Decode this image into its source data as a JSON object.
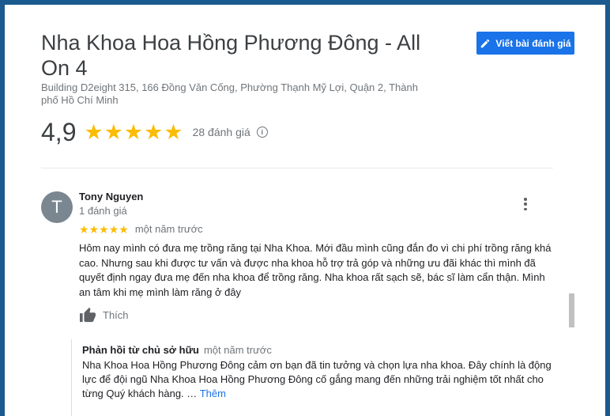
{
  "business": {
    "title": "Nha Khoa Hoa Hồng Phương Đông - All On 4",
    "address": "Building D2eight 315, 166 Đồng Văn Cống, Phường Thạnh Mỹ Lợi, Quận 2, Thành phố Hồ Chí Minh",
    "rating": "4,9",
    "rating_value": 4.9,
    "review_count": "28 đánh giá",
    "info_icon": "info-icon"
  },
  "actions": {
    "write_review": "Viết bài đánh giá",
    "write_icon": "pencil-icon"
  },
  "review": {
    "avatar_letter": "T",
    "author": "Tony Nguyen",
    "author_review_count": "1 đánh giá",
    "stars": 5,
    "time": "một năm trước",
    "text": "Hôm nay mình có đưa mẹ trồng răng tại Nha Khoa. Mới đầu mình cũng đắn đo vì chi phí trồng răng khá cao. Nhưng sau khi được tư vấn và được nha khoa hỗ trợ trả góp và những ưu đãi khác thì mình đã quyết định ngay đưa mẹ đến nha khoa để trồng răng. Nha khoa rất sạch sẽ, bác sĩ làm cẩn thận. Mình an tâm khi mẹ mình làm răng ở đây",
    "like_label": "Thích",
    "more_icon": "more-vert-icon"
  },
  "owner_reply": {
    "title": "Phản hồi từ chủ sở hữu",
    "time": "một năm trước",
    "text": "Nha Khoa Hoa Hồng Phương Đông cảm ơn bạn đã tin tưởng và chọn lựa nha khoa. Đây chính là động lực để đội ngũ Nha Khoa Hoa Hồng Phương Đông cố gắng mang đến những trải nghiệm tốt nhất cho từng Quý khách hàng. …",
    "more_link": "Thêm"
  },
  "colors": {
    "frame": "#1a5a8e",
    "accent": "#1a73e8",
    "star": "#fbbc04",
    "avatar": "#7a8791"
  }
}
